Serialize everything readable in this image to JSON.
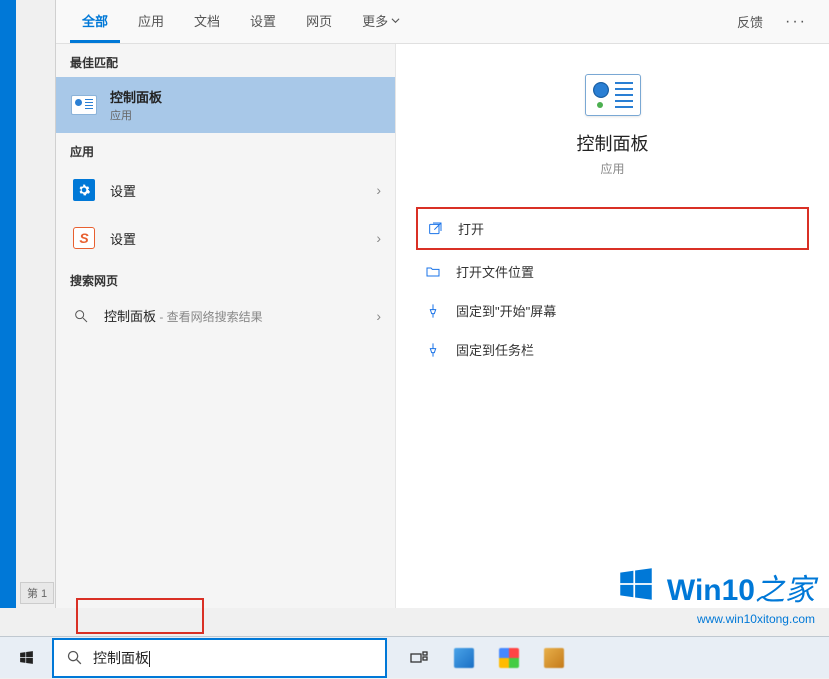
{
  "tabs": {
    "items": [
      "全部",
      "应用",
      "文档",
      "设置",
      "网页",
      "更多"
    ],
    "feedback": "反馈"
  },
  "sections": {
    "best_match": "最佳匹配",
    "apps": "应用",
    "web": "搜索网页"
  },
  "results": {
    "best": {
      "title": "控制面板",
      "sub": "应用"
    },
    "settings1": "设置",
    "settings2": "设置",
    "web_prefix": "控制面板",
    "web_suffix": " - 查看网络搜索结果"
  },
  "preview": {
    "title": "控制面板",
    "sub": "应用"
  },
  "actions": {
    "open": "打开",
    "open_location": "打开文件位置",
    "pin_start": "固定到\"开始\"屏幕",
    "pin_taskbar": "固定到任务栏"
  },
  "searchbox": {
    "value": "控制面板"
  },
  "page_label": "第 1",
  "watermark": {
    "brand_a": "Win10",
    "brand_b": "之家",
    "url": "www.win10xitong.com"
  }
}
